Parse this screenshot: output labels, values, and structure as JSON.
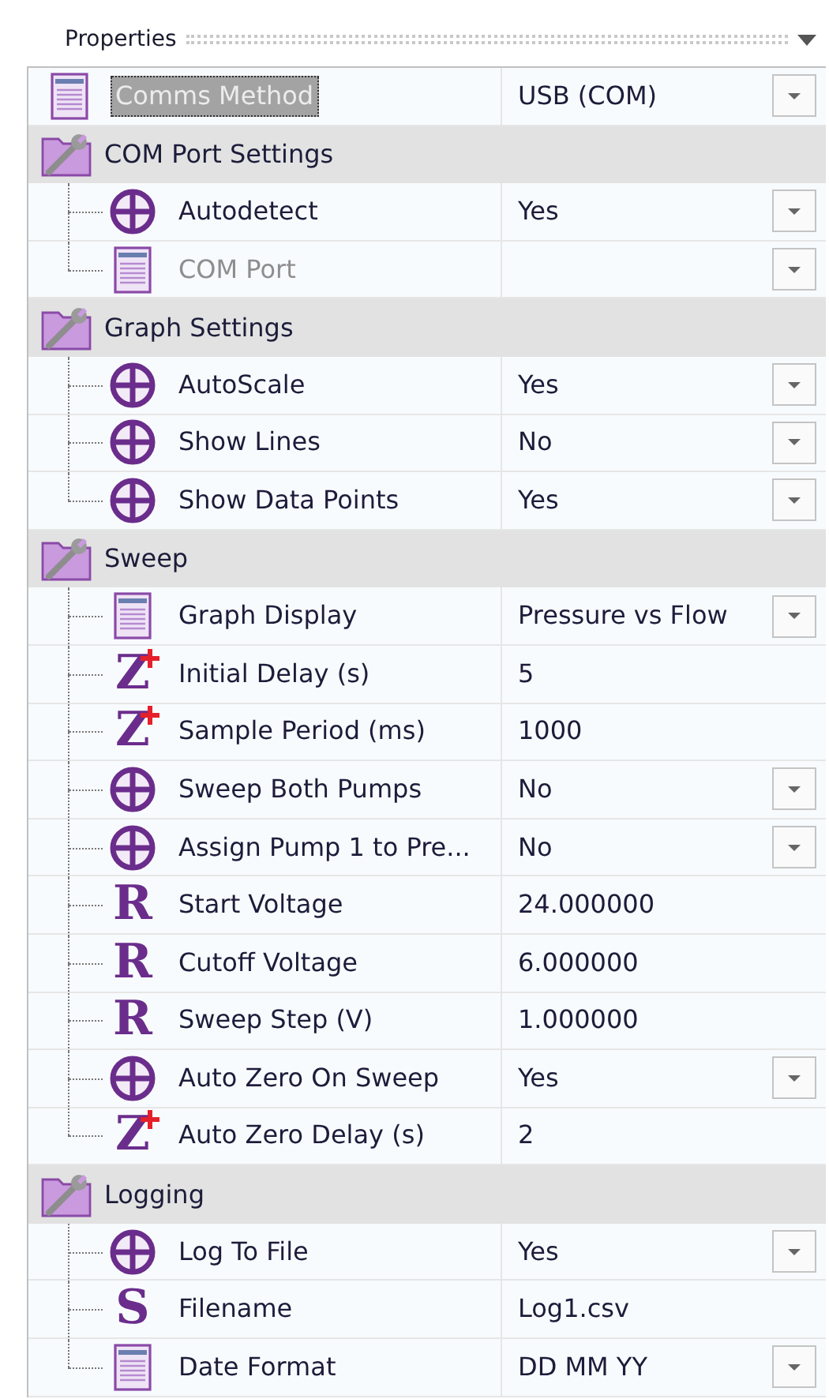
{
  "panel": {
    "title": "Properties"
  },
  "rows": [
    {
      "kind": "list",
      "label": "Comms Method",
      "value": "USB (COM)",
      "dropdown": true,
      "selected": true,
      "disabled": false
    },
    {
      "kind": "category",
      "label": "COM Port Settings",
      "children": [
        {
          "kind": "enum",
          "label": "Autodetect",
          "value": "Yes",
          "dropdown": true,
          "selected": false,
          "disabled": false
        },
        {
          "kind": "list",
          "label": "COM Port",
          "dropdown": true,
          "selected": false,
          "disabled": true
        }
      ]
    },
    {
      "kind": "category",
      "label": "Graph Settings",
      "children": [
        {
          "kind": "enum",
          "label": "AutoScale",
          "value": "Yes",
          "dropdown": true,
          "selected": false,
          "disabled": false
        },
        {
          "kind": "enum",
          "label": "Show Lines",
          "value": "No",
          "dropdown": true,
          "selected": false,
          "disabled": false
        },
        {
          "kind": "enum",
          "label": "Show Data Points",
          "value": "Yes",
          "dropdown": true,
          "selected": false,
          "disabled": false
        }
      ]
    },
    {
      "kind": "category",
      "label": "Sweep",
      "children": [
        {
          "kind": "list",
          "label": "Graph Display",
          "value": "Pressure vs Flow",
          "dropdown": true,
          "selected": false,
          "disabled": false
        },
        {
          "kind": "int",
          "glyph": "Z",
          "label": "Initial Delay (s)",
          "value": "5",
          "dropdown": false,
          "selected": false,
          "disabled": false
        },
        {
          "kind": "int",
          "glyph": "Z",
          "label": "Sample Period (ms)",
          "value": "1000",
          "dropdown": false,
          "selected": false,
          "disabled": false
        },
        {
          "kind": "enum",
          "label": "Sweep Both Pumps",
          "value": "No",
          "dropdown": true,
          "selected": false,
          "disabled": false
        },
        {
          "kind": "enum",
          "label": "Assign Pump 1 to Pre...",
          "value": "No",
          "dropdown": true,
          "selected": false,
          "disabled": false
        },
        {
          "kind": "real",
          "glyph": "R",
          "label": "Start Voltage",
          "value": "24.000000",
          "dropdown": false,
          "selected": false,
          "disabled": false
        },
        {
          "kind": "real",
          "glyph": "R",
          "label": "Cutoff Voltage",
          "value": "6.000000",
          "dropdown": false,
          "selected": false,
          "disabled": false
        },
        {
          "kind": "real",
          "glyph": "R",
          "label": "Sweep Step (V)",
          "value": "1.000000",
          "dropdown": false,
          "selected": false,
          "disabled": false
        },
        {
          "kind": "enum",
          "label": "Auto Zero On Sweep",
          "value": "Yes",
          "dropdown": true,
          "selected": false,
          "disabled": false
        },
        {
          "kind": "int",
          "glyph": "Z",
          "label": "Auto Zero Delay (s)",
          "value": "2",
          "dropdown": false,
          "selected": false,
          "disabled": false
        }
      ]
    },
    {
      "kind": "category",
      "label": "Logging",
      "children": [
        {
          "kind": "enum",
          "label": "Log To File",
          "value": "Yes",
          "dropdown": true,
          "selected": false,
          "disabled": false
        },
        {
          "kind": "string",
          "glyph": "S",
          "label": "Filename",
          "value": "Log1.csv",
          "dropdown": false,
          "selected": false,
          "disabled": false
        },
        {
          "kind": "list",
          "label": "Date Format",
          "value": "DD MM YY",
          "dropdown": true,
          "selected": false,
          "disabled": false
        }
      ]
    }
  ]
}
